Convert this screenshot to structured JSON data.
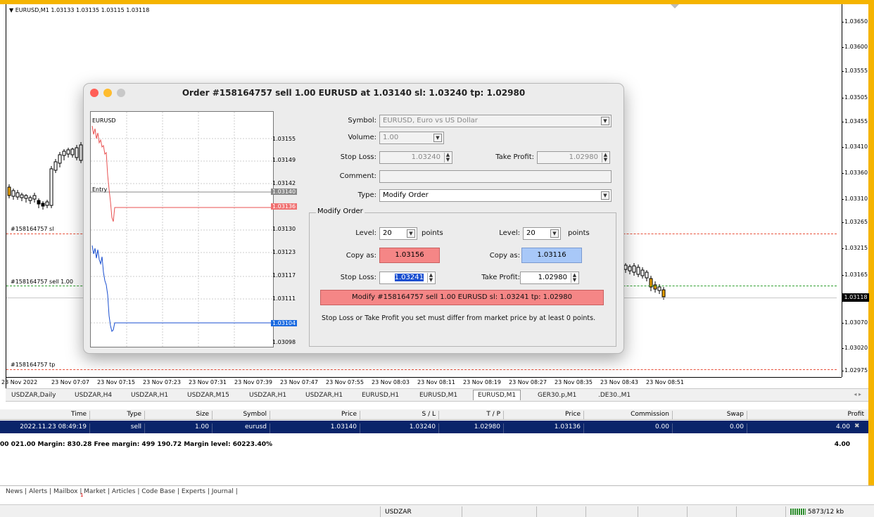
{
  "chart": {
    "title": "▼ EURUSD,M1  1.03133 1.03135 1.03115 1.03118",
    "price_labels": [
      "1.03650",
      "1.03600",
      "1.03555",
      "1.03505",
      "1.03455",
      "1.03410",
      "1.03360",
      "1.03310",
      "1.03265",
      "1.03215",
      "1.03165",
      "1.03070",
      "1.03020",
      "1.02975"
    ],
    "current_price": "1.03118",
    "sl_label": "#158164757 sl",
    "order_label": "#158164757 sell 1.00",
    "tp_label": "#158164757 tp",
    "time_labels": [
      "23 Nov 2022",
      "23 Nov 07:07",
      "23 Nov 07:15",
      "23 Nov 07:23",
      "23 Nov 07:31",
      "23 Nov 07:39",
      "23 Nov 07:47",
      "23 Nov 07:55",
      "23 Nov 08:03",
      "23 Nov 08:11",
      "23 Nov 08:19",
      "23 Nov 08:27",
      "23 Nov 08:35",
      "23 Nov 08:43",
      "23 Nov 08:51"
    ]
  },
  "dialog": {
    "title": "Order #158164757 sell 1.00 EURUSD at 1.03140 sl: 1.03240 tp: 1.02980",
    "mini_chart": {
      "symbol": "EURUSD",
      "entry_label": "Entry",
      "price_labels": [
        "1.03155",
        "1.03149",
        "1.03142",
        "1.03140",
        "1.03136",
        "1.03130",
        "1.03123",
        "1.03117",
        "1.03111",
        "1.03104",
        "1.03098"
      ]
    },
    "symbol_label": "Symbol:",
    "symbol_value": "EURUSD, Euro vs US Dollar",
    "volume_label": "Volume:",
    "volume_value": "1.00",
    "stop_loss_label": "Stop Loss:",
    "stop_loss_value": "1.03240",
    "take_profit_label": "Take Profit:",
    "take_profit_value": "1.02980",
    "comment_label": "Comment:",
    "comment_value": "",
    "type_label": "Type:",
    "type_value": "Modify Order",
    "group_title": "Modify Order",
    "level_label": "Level:",
    "level_sl_value": "20",
    "level_tp_value": "20",
    "points_label": "points",
    "copy_as_label": "Copy as:",
    "copy_sl_value": "1.03156",
    "copy_tp_value": "1.03116",
    "mod_sl_label": "Stop Loss:",
    "mod_sl_value": "1.03241",
    "mod_tp_label": "Take Profit:",
    "mod_tp_value": "1.02980",
    "modify_button": "Modify #158164757 sell 1.00 EURUSD sl: 1.03241 tp: 1.02980",
    "note": "Stop Loss or Take Profit you set must differ from market price by at least 0 points."
  },
  "chart_tabs": [
    "USDZAR,Daily",
    "USDZAR,H4",
    "USDZAR,H1",
    "USDZAR,M15",
    "USDZAR,H1",
    "USDZAR,H1",
    "EURUSD,H1",
    "EURUSD,M1",
    "EURUSD,M1",
    "GER30.p,M1",
    ".DE30.,M1"
  ],
  "tab_arrows": "◂ ▸",
  "table": {
    "headers": [
      "Time",
      "Type",
      "Size",
      "Symbol",
      "Price",
      "S / L",
      "T / P",
      "Price",
      "Commission",
      "Swap",
      "Profit"
    ],
    "row": [
      "2022.11.23 08:49:19",
      "sell",
      "1.00",
      "eurusd",
      "1.03140",
      "1.03240",
      "1.02980",
      "1.03136",
      "0.00",
      "0.00",
      "4.00"
    ],
    "close_glyph": "✖"
  },
  "summary": {
    "text": "00 021.00  Margin: 830.28  Free margin: 499 190.72  Margin level: 60223.40%",
    "profit": "4.00"
  },
  "bottom_tabs": "News  |  Alerts  |  Mailbox   |  Market  |  Articles  |  Code Base  |  Experts  |  Journal  |",
  "mailbox_badge": "1",
  "status": {
    "symbol": "USDZAR",
    "traffic": "5873/12 kb"
  }
}
